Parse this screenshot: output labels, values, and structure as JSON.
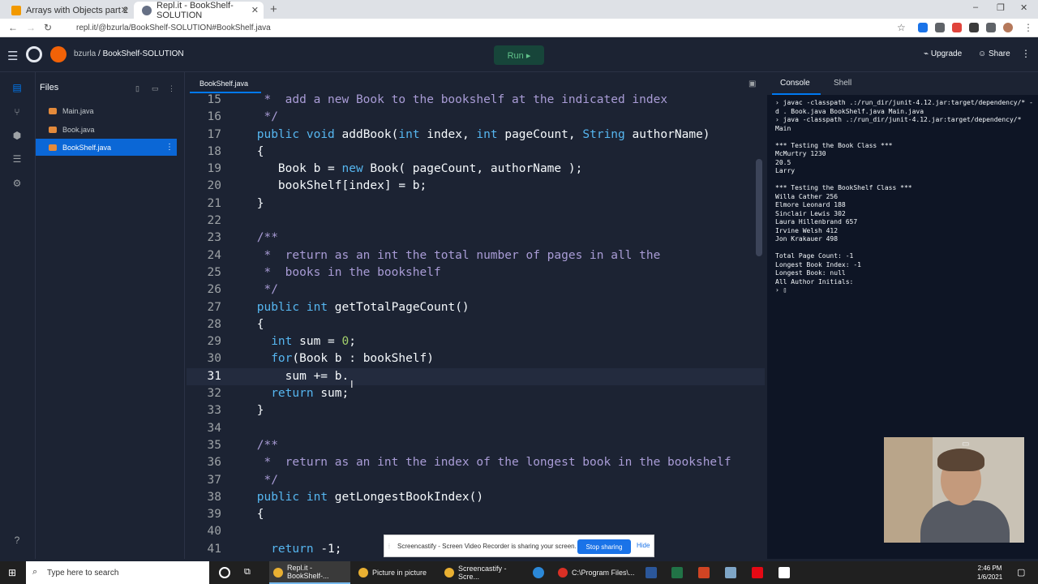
{
  "browser": {
    "tabs": [
      {
        "label": "Arrays with Objects part 2",
        "active": false
      },
      {
        "label": "Repl.it - BookShelf-SOLUTION",
        "active": true
      }
    ],
    "url": "repl.it/@bzurla/BookShelf-SOLUTION#BookShelf.java"
  },
  "header": {
    "user": "bzurla",
    "separator": "/",
    "project": "BookShelf-SOLUTION",
    "run_label": "Run ▸",
    "upgrade_label": "Upgrade",
    "share_label": "Share"
  },
  "files_panel": {
    "title": "Files",
    "items": [
      {
        "name": "Main.java",
        "active": false
      },
      {
        "name": "Book.java",
        "active": false
      },
      {
        "name": "BookShelf.java",
        "active": true
      }
    ]
  },
  "editor": {
    "tab_label": "BookShelf.java",
    "current_line": 31,
    "lines": [
      {
        "num": "15",
        "text": "  *  add a new Book to the bookshelf at the indicated index",
        "cls": "c"
      },
      {
        "num": "16",
        "text": "  */",
        "cls": "c"
      },
      {
        "num": "17",
        "text": " public void addBook(int index, int pageCount, String authorName)",
        "cls": ""
      },
      {
        "num": "18",
        "text": " {",
        "cls": ""
      },
      {
        "num": "19",
        "text": "    Book b = new Book( pageCount, authorName );",
        "cls": ""
      },
      {
        "num": "20",
        "text": "    bookShelf[index] = b;",
        "cls": ""
      },
      {
        "num": "21",
        "text": " }",
        "cls": ""
      },
      {
        "num": "22",
        "text": "",
        "cls": ""
      },
      {
        "num": "23",
        "text": " /**",
        "cls": "c"
      },
      {
        "num": "24",
        "text": "  *  return as an int the total number of pages in all the",
        "cls": "c"
      },
      {
        "num": "25",
        "text": "  *  books in the bookshelf",
        "cls": "c"
      },
      {
        "num": "26",
        "text": "  */",
        "cls": "c"
      },
      {
        "num": "27",
        "text": " public int getTotalPageCount()",
        "cls": ""
      },
      {
        "num": "28",
        "text": " {",
        "cls": ""
      },
      {
        "num": "29",
        "text": "   int sum = 0;",
        "cls": ""
      },
      {
        "num": "30",
        "text": "   for(Book b : bookShelf)",
        "cls": ""
      },
      {
        "num": "31",
        "text": "     sum += b.",
        "cls": ""
      },
      {
        "num": "32",
        "text": "   return sum;",
        "cls": ""
      },
      {
        "num": "33",
        "text": " }",
        "cls": ""
      },
      {
        "num": "34",
        "text": "",
        "cls": ""
      },
      {
        "num": "35",
        "text": " /**",
        "cls": "c"
      },
      {
        "num": "36",
        "text": "  *  return as an int the index of the longest book in the bookshelf",
        "cls": "c"
      },
      {
        "num": "37",
        "text": "  */",
        "cls": "c"
      },
      {
        "num": "38",
        "text": " public int getLongestBookIndex()",
        "cls": ""
      },
      {
        "num": "39",
        "text": " {",
        "cls": ""
      },
      {
        "num": "40",
        "text": "",
        "cls": ""
      },
      {
        "num": "41",
        "text": "   return -1;",
        "cls": ""
      }
    ]
  },
  "console": {
    "tabs": [
      {
        "label": "Console",
        "active": true
      },
      {
        "label": "Shell",
        "active": false
      }
    ],
    "output": [
      "› javac -classpath .:/run_dir/junit-4.12.jar:target/dependency/* -d . Book.java BookShelf.java Main.java",
      "› java -classpath .:/run_dir/junit-4.12.jar:target/dependency/* Main",
      "",
      "*** Testing the Book Class ***",
      "McMurtry 1230",
      "20.5",
      "Larry",
      "",
      "*** Testing the BookShelf Class ***",
      "Willa Cather 256",
      "Elmore Leonard 188",
      "Sinclair Lewis 302",
      "Laura Hillenbrand 657",
      "Irvine Welsh 412",
      "Jon Krakauer 498",
      "",
      "Total Page Count: -1",
      "Longest Book Index: -1",
      "Longest Book: null",
      "All Author Initials:",
      "› ▯"
    ]
  },
  "share_notice": {
    "text": "Screencastify - Screen Video Recorder is sharing your screen.",
    "stop_label": "Stop sharing",
    "hide_label": "Hide"
  },
  "taskbar": {
    "search_placeholder": "Type here to search",
    "items": [
      {
        "label": "Repl.it - BookShelf-...",
        "active": true
      },
      {
        "label": "Picture in picture",
        "active": false
      },
      {
        "label": "Screencastify - Scre...",
        "active": false
      },
      {
        "label": "C:\\Program Files\\...",
        "active": false
      }
    ],
    "time": "2:46 PM",
    "date": "1/6/2021"
  },
  "colors": {
    "accent": "#0079f2",
    "run_bg": "#17453a",
    "file_active": "#0b67d6"
  }
}
